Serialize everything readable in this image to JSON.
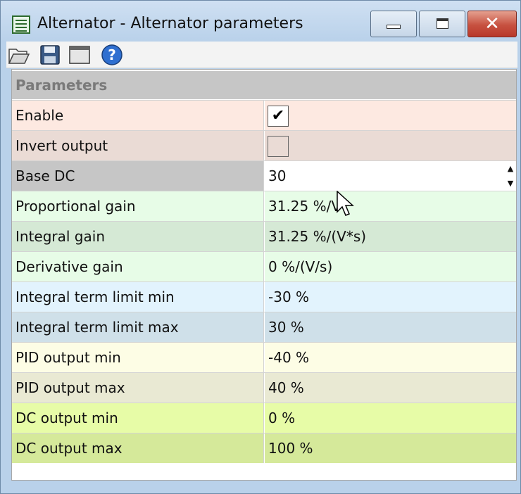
{
  "window": {
    "title": "Alternator - Alternator parameters",
    "controls": {
      "minimize": "minimize",
      "maximize": "maximize",
      "close": "✕"
    }
  },
  "toolbar": {
    "buttons": [
      "open-folder-icon",
      "save-icon",
      "window-icon",
      "help-icon"
    ]
  },
  "section": {
    "title": "Parameters"
  },
  "rows": [
    {
      "label": "Enable",
      "value": "",
      "kind": "checkbox",
      "checked": true,
      "color_label": "#fde9e1",
      "color_value": "#fde9e1"
    },
    {
      "label": "Invert output",
      "value": "",
      "kind": "checkbox",
      "checked": false,
      "color_label": "#eadbd5",
      "color_value": "#eadbd5"
    },
    {
      "label": "Base DC",
      "value": "30",
      "kind": "spin",
      "color_label": "#c6c6c6",
      "color_value": "#ffffff"
    },
    {
      "label": "Proportional gain",
      "value": "31.25 %/V",
      "color_label": "#e7fce7",
      "color_value": "#e7fce7"
    },
    {
      "label": "Integral gain",
      "value": "31.25 %/(V*s)",
      "color_label": "#d5e9d5",
      "color_value": "#d5e9d5"
    },
    {
      "label": "Derivative gain",
      "value": "0 %/(V/s)",
      "color_label": "#e7fce7",
      "color_value": "#e7fce7"
    },
    {
      "label": "Integral term limit min",
      "value": "-30 %",
      "color_label": "#e2f3fd",
      "color_value": "#e2f3fd"
    },
    {
      "label": "Integral term limit max",
      "value": "30 %",
      "color_label": "#cfe0e9",
      "color_value": "#cfe0e9"
    },
    {
      "label": "PID output min",
      "value": "-40 %",
      "color_label": "#fdfde5",
      "color_value": "#fdfde5"
    },
    {
      "label": "PID output max",
      "value": "40 %",
      "color_label": "#e9e9d3",
      "color_value": "#e9e9d3"
    },
    {
      "label": "DC output min",
      "value": "0 %",
      "color_label": "#e7fca7",
      "color_value": "#e7fca7"
    },
    {
      "label": "DC output max",
      "value": "100 %",
      "color_label": "#d5e99a",
      "color_value": "#d5e99a"
    }
  ]
}
